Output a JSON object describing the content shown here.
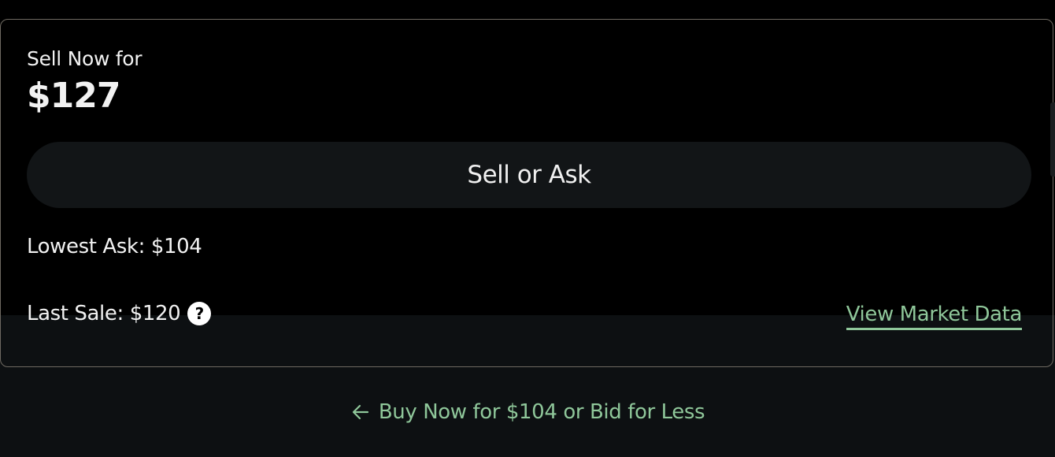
{
  "sell": {
    "label": "Sell Now for",
    "price": "$127",
    "button_label": "Sell or Ask"
  },
  "market": {
    "lowest_ask": "Lowest Ask: $104",
    "last_sale": "Last Sale: $120",
    "help_glyph": "?",
    "view_market_data": "View Market Data"
  },
  "buy": {
    "link_label": "Buy Now for $104 or Bid for Less"
  },
  "icons": {
    "help": "help-icon",
    "arrow": "arrow-left-icon"
  },
  "colors": {
    "accent": "#8fc79a",
    "background": "#000000",
    "button": "#121517",
    "border": "#6f6a62"
  }
}
